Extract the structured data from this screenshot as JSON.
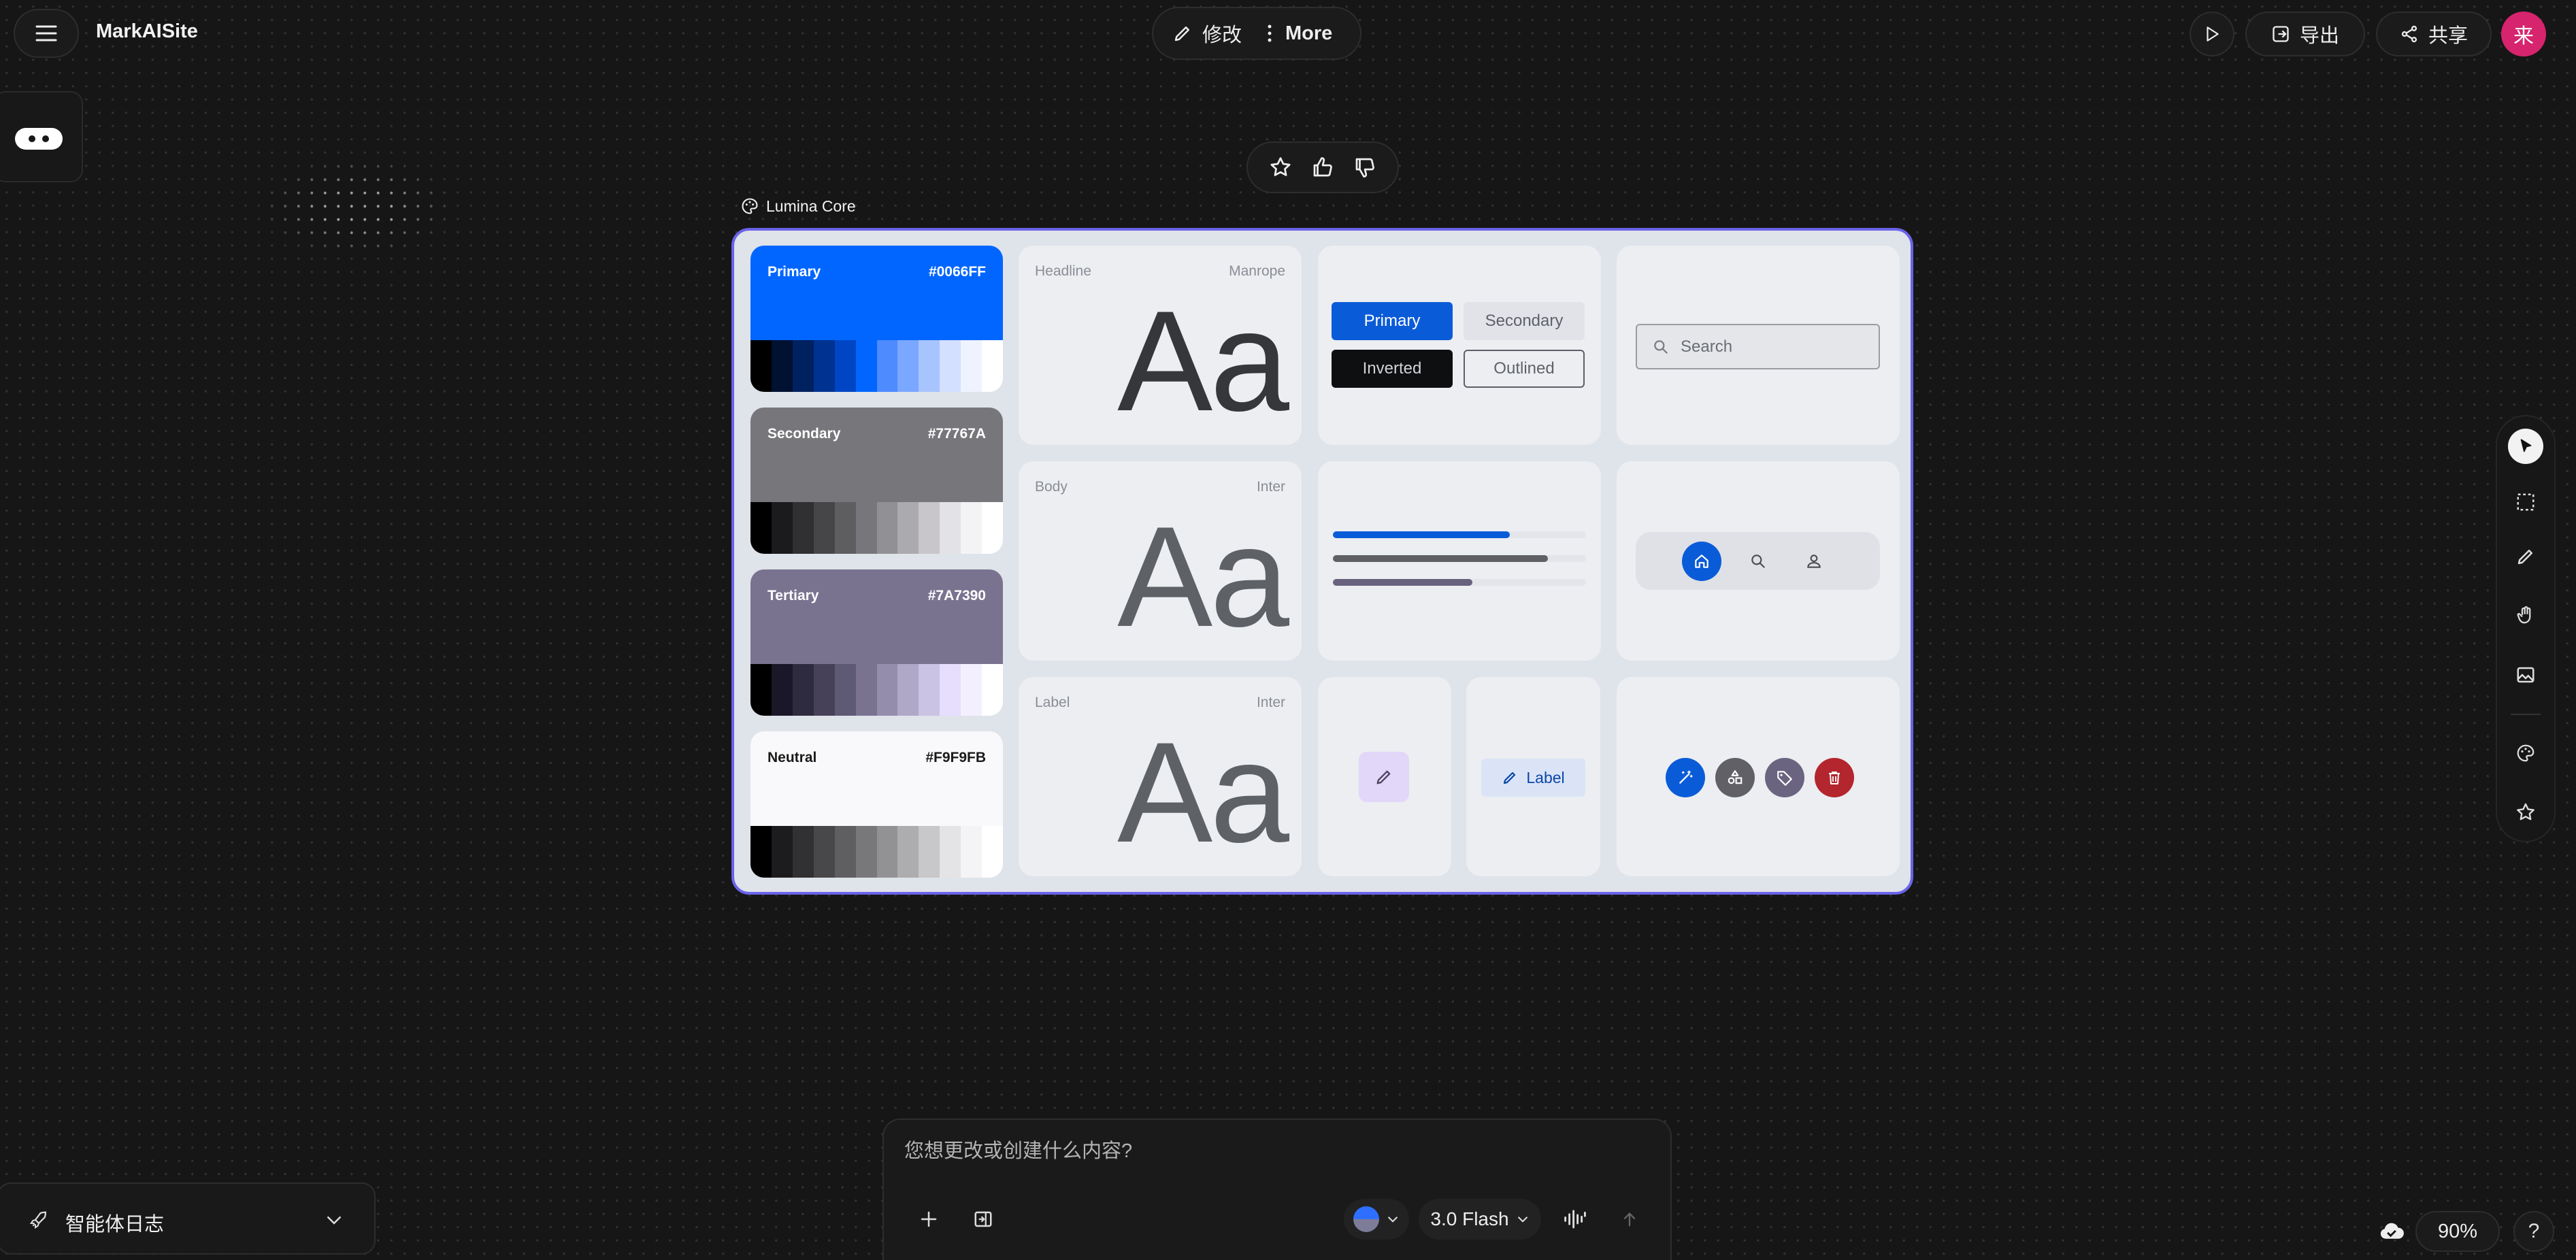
{
  "app": {
    "title": "MarkAISite"
  },
  "toolbar": {
    "edit_label": "修改",
    "more_label": "More"
  },
  "header_right": {
    "export_label": "导出",
    "share_label": "共享",
    "avatar_char": "来"
  },
  "canvas": {
    "frame_title": "Lumina Core"
  },
  "colors": {
    "accent": "#6A63E8",
    "primary": "#0066FF",
    "avatar": "#D6246E"
  },
  "palettes": [
    {
      "name": "Primary",
      "hex": "#0066FF"
    },
    {
      "name": "Secondary",
      "hex": "#77767A"
    },
    {
      "name": "Tertiary",
      "hex": "#7A7390"
    },
    {
      "name": "Neutral",
      "hex": "#F9F9FB"
    }
  ],
  "typography": [
    {
      "label": "Headline",
      "font": "Manrope",
      "sample": "Aa"
    },
    {
      "label": "Body",
      "font": "Inter",
      "sample": "Aa"
    },
    {
      "label": "Label",
      "font": "Inter",
      "sample": "Aa"
    }
  ],
  "buttons": {
    "primary": "Primary",
    "secondary": "Secondary",
    "inverted": "Inverted",
    "outlined": "Outlined"
  },
  "search": {
    "placeholder": "Search"
  },
  "progress": [
    0.7,
    0.85,
    0.55
  ],
  "chip": {
    "label": "Label"
  },
  "prompt": {
    "placeholder": "您想更改或创建什么内容?",
    "model_label": "3.0 Flash"
  },
  "agent_log": {
    "label": "智能体日志"
  },
  "zoom": {
    "level": "90%"
  },
  "icons": [
    "menu-icon",
    "pencil-icon",
    "more-vert-icon",
    "play-icon",
    "export-icon",
    "share-icon",
    "star-icon",
    "thumbs-up-icon",
    "thumbs-down-icon",
    "palette-icon",
    "pointer-icon",
    "marquee-icon",
    "hand-icon",
    "image-icon",
    "plus-icon",
    "waveform-icon",
    "send-icon",
    "rocket-icon",
    "chevron-down-icon",
    "cloud-check-icon",
    "help-icon"
  ]
}
